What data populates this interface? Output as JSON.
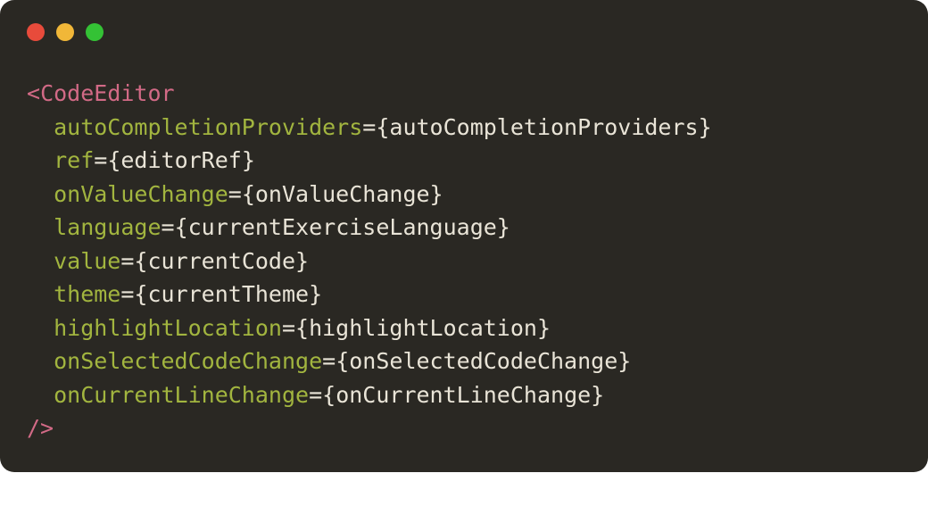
{
  "code": {
    "open_bracket": "<",
    "close_open": "/>",
    "component": "CodeEditor",
    "props": [
      {
        "name": "autoCompletionProviders",
        "value": "{autoCompletionProviders}"
      },
      {
        "name": "ref",
        "value": "{editorRef}"
      },
      {
        "name": "onValueChange",
        "value": "{onValueChange}"
      },
      {
        "name": "language",
        "value": "{currentExerciseLanguage}"
      },
      {
        "name": "value",
        "value": "{currentCode}"
      },
      {
        "name": "theme",
        "value": "{currentTheme}"
      },
      {
        "name": "highlightLocation",
        "value": "{highlightLocation}"
      },
      {
        "name": "onSelectedCodeChange",
        "value": "{onSelectedCodeChange}"
      },
      {
        "name": "onCurrentLineChange",
        "value": "{onCurrentLineChange}"
      }
    ]
  }
}
